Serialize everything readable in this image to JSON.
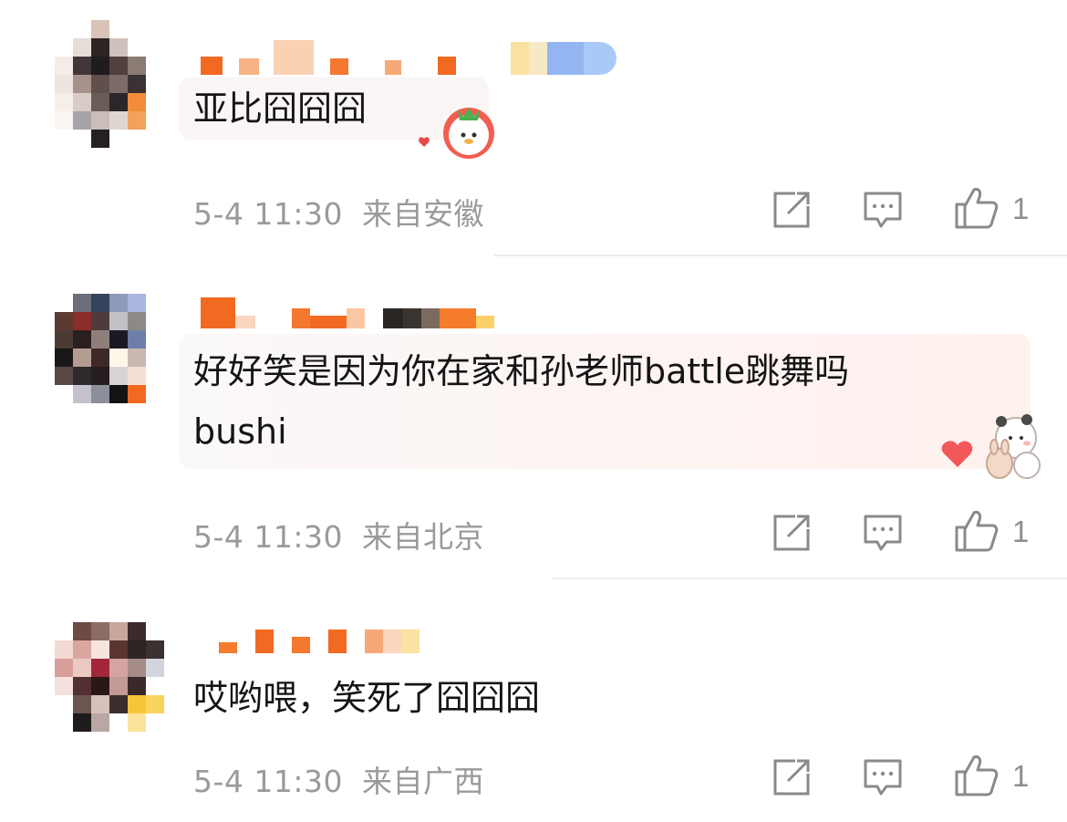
{
  "comments": [
    {
      "text": "亚比囧囧囧",
      "time": "5-4 11:30",
      "location": "来自安徽",
      "like_count": "1"
    },
    {
      "text_line1": "好好笑是因为你在家和孙老师battle跳舞吗",
      "text_line2": "bushi",
      "time": "5-4 11:30",
      "location": "来自北京",
      "like_count": "1"
    },
    {
      "text": "哎哟喂，笑死了囧囧囧",
      "time": "5-4 11:30",
      "location": "来自广西",
      "like_count": "1"
    }
  ],
  "icons": {
    "share": "share-icon",
    "reply": "comment-icon",
    "like": "thumbs-up-icon"
  },
  "colors": {
    "nickname_orange": "#f47a2c",
    "meta_gray": "#9a9a9a",
    "icon_gray": "#8a8a8a",
    "bubble_pink": "#fff1ee"
  }
}
